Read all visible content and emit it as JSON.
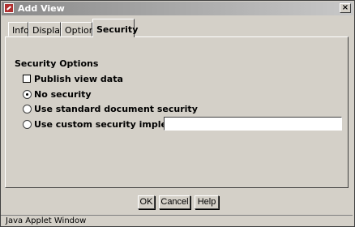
{
  "window": {
    "title": "Add View",
    "close_glyph": "×"
  },
  "tabs": [
    {
      "label": "Info"
    },
    {
      "label": "Display"
    },
    {
      "label": "Options"
    },
    {
      "label": "Security",
      "active": true
    }
  ],
  "security": {
    "section_title": "Security Options",
    "publish_label": "Publish view data",
    "publish_checked": false,
    "radio_options": [
      {
        "label": "No security",
        "checked": true
      },
      {
        "label": "Use standard document security",
        "checked": false
      },
      {
        "label": "Use custom security implementor:",
        "checked": false
      }
    ],
    "custom_value": ""
  },
  "buttons": {
    "ok": "OK",
    "cancel": "Cancel",
    "help": "Help"
  },
  "status": {
    "text": "Java Applet Window"
  },
  "icons": {
    "app": "oracle-app-icon",
    "close": "close-icon"
  }
}
